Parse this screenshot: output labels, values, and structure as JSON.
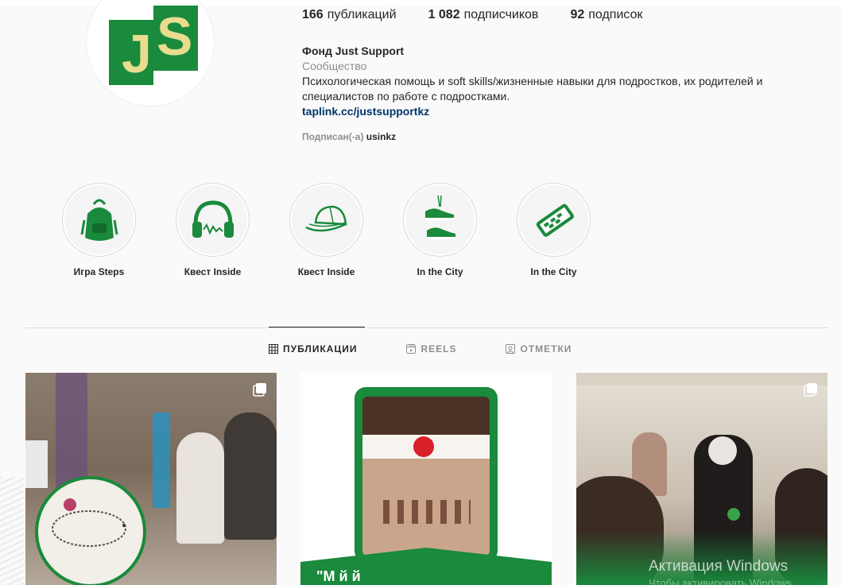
{
  "profile": {
    "stats": {
      "posts_count": "166",
      "posts_label": "публикаций",
      "followers_count": "1 082",
      "followers_label": "подписчиков",
      "following_count": "92",
      "following_label": "подписок"
    },
    "name": "Фонд Just Support",
    "category": "Сообщество",
    "description": "Психологическая помощь и soft skills/жизненные навыки для подростков, их родителей и специалистов по работе с подростками.",
    "link": "taplink.cc/justsupportkz",
    "followed_by_label": "Подписан(-а)",
    "followed_by_user": "usinkz",
    "avatar_text": "JS"
  },
  "highlights": [
    {
      "label": "Игра Steps",
      "icon": "backpack-icon"
    },
    {
      "label": "Квест Inside",
      "icon": "headphones-icon"
    },
    {
      "label": "Квест Inside",
      "icon": "cap-icon"
    },
    {
      "label": "In the City",
      "icon": "sneakers-icon"
    },
    {
      "label": "In the City",
      "icon": "phone-icon"
    }
  ],
  "tabs": [
    {
      "label": "ПУБЛИКАЦИИ",
      "icon": "grid-icon",
      "active": true
    },
    {
      "label": "REELS",
      "icon": "reels-icon",
      "active": false
    },
    {
      "label": "ОТМЕТКИ",
      "icon": "tagged-icon",
      "active": false
    }
  ],
  "posts": {
    "post2_caption": "\"М          й     й",
    "watermark_title": "Активация Windows",
    "watermark_sub": "Чтобы активировать Windows"
  },
  "colors": {
    "brand_green": "#1a8a3c",
    "logo_yellow": "#e8dc8f",
    "link": "#00376b",
    "muted": "#8e8e8e"
  }
}
